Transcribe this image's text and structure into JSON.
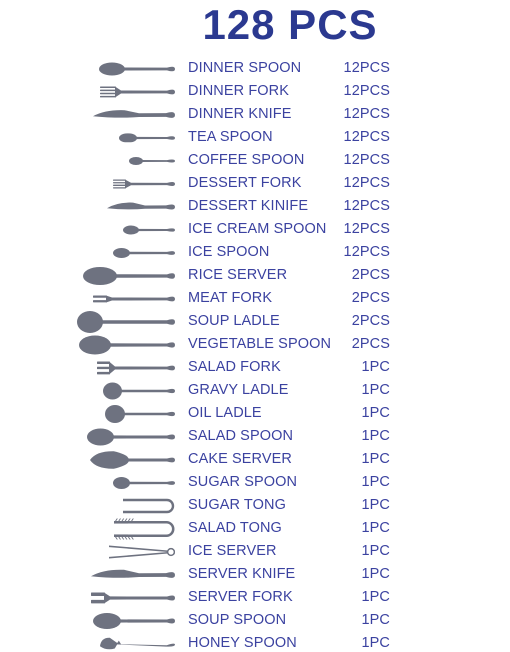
{
  "title": "128 PCS",
  "colors": {
    "title": "#2B3990",
    "text": "#3B42A0",
    "icon": "#6E7280",
    "background": "#FFFFFF"
  },
  "items": [
    {
      "icon": "dinner-spoon-icon",
      "label": "DINNER SPOON",
      "qty": "12PCS"
    },
    {
      "icon": "dinner-fork-icon",
      "label": "DINNER FORK",
      "qty": "12PCS"
    },
    {
      "icon": "dinner-knife-icon",
      "label": "DINNER KNIFE",
      "qty": "12PCS"
    },
    {
      "icon": "tea-spoon-icon",
      "label": "TEA SPOON",
      "qty": "12PCS"
    },
    {
      "icon": "coffee-spoon-icon",
      "label": "COFFEE SPOON",
      "qty": "12PCS"
    },
    {
      "icon": "dessert-fork-icon",
      "label": "DESSERT FORK",
      "qty": "12PCS"
    },
    {
      "icon": "dessert-knife-icon",
      "label": "DESSERT KINIFE",
      "qty": "12PCS"
    },
    {
      "icon": "ice-cream-spoon-icon",
      "label": "ICE CREAM SPOON",
      "qty": "12PCS"
    },
    {
      "icon": "ice-spoon-icon",
      "label": "ICE SPOON",
      "qty": "12PCS"
    },
    {
      "icon": "rice-server-icon",
      "label": "RICE SERVER",
      "qty": "2PCS"
    },
    {
      "icon": "meat-fork-icon",
      "label": "MEAT FORK",
      "qty": "2PCS"
    },
    {
      "icon": "soup-ladle-icon",
      "label": "SOUP LADLE",
      "qty": "2PCS"
    },
    {
      "icon": "vegetable-spoon-icon",
      "label": "VEGETABLE SPOON",
      "qty": "2PCS"
    },
    {
      "icon": "salad-fork-icon",
      "label": "SALAD FORK",
      "qty": "1PC"
    },
    {
      "icon": "gravy-ladle-icon",
      "label": "GRAVY LADLE",
      "qty": "1PC"
    },
    {
      "icon": "oil-ladle-icon",
      "label": "OIL LADLE",
      "qty": "1PC"
    },
    {
      "icon": "salad-spoon-icon",
      "label": "SALAD SPOON",
      "qty": "1PC"
    },
    {
      "icon": "cake-server-icon",
      "label": "CAKE SERVER",
      "qty": "1PC"
    },
    {
      "icon": "sugar-spoon-icon",
      "label": "SUGAR SPOON",
      "qty": "1PC"
    },
    {
      "icon": "sugar-tong-icon",
      "label": "SUGAR TONG",
      "qty": "1PC"
    },
    {
      "icon": "salad-tong-icon",
      "label": "SALAD TONG",
      "qty": "1PC"
    },
    {
      "icon": "ice-server-icon",
      "label": "ICE SERVER",
      "qty": "1PC"
    },
    {
      "icon": "server-knife-icon",
      "label": "SERVER KNIFE",
      "qty": "1PC"
    },
    {
      "icon": "server-fork-icon",
      "label": "SERVER FORK",
      "qty": "1PC"
    },
    {
      "icon": "soup-spoon-icon",
      "label": "SOUP SPOON",
      "qty": "1PC"
    },
    {
      "icon": "honey-spoon-icon",
      "label": "HONEY SPOON",
      "qty": "1PC"
    }
  ]
}
